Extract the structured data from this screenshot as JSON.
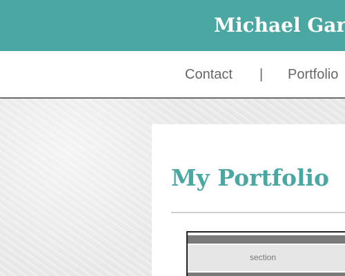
{
  "header": {
    "site_title": "Michael Gar"
  },
  "nav": {
    "items": [
      {
        "label": "Contact"
      },
      {
        "label": "|"
      },
      {
        "label": "Portfolio"
      }
    ]
  },
  "main": {
    "page_title": "My Portfolio",
    "preview": {
      "section_label": "section"
    }
  },
  "colors": {
    "header_bg": "#4aa7a2",
    "title_teal": "#4aa7a2",
    "nav_text": "#666666",
    "page_bg": "#ececec"
  }
}
